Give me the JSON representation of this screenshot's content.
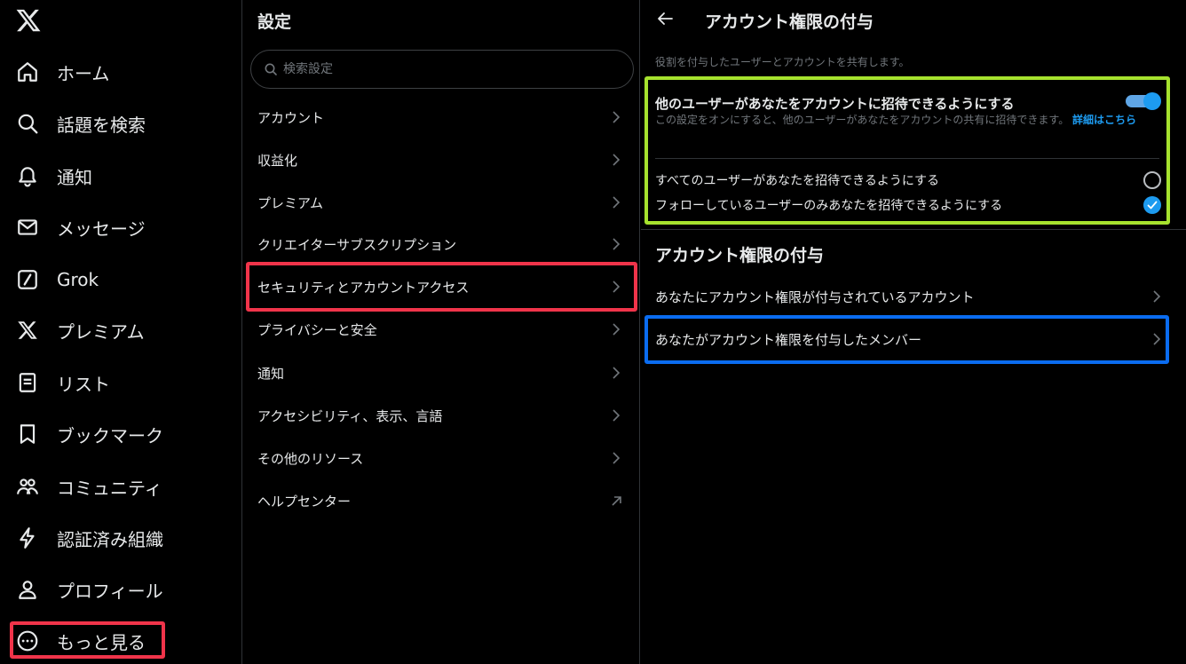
{
  "colors": {
    "accent": "#1d9bf0",
    "highlight_red": "#f0344a",
    "highlight_green": "#a6e22e",
    "highlight_blue": "#0a6cf0"
  },
  "nav": {
    "logo_icon": "x-logo-icon",
    "items": [
      {
        "label": "ホーム",
        "icon": "home-icon"
      },
      {
        "label": "話題を検索",
        "icon": "search-icon"
      },
      {
        "label": "通知",
        "icon": "bell-icon"
      },
      {
        "label": "メッセージ",
        "icon": "mail-icon"
      },
      {
        "label": "Grok",
        "icon": "grok-icon"
      },
      {
        "label": "プレミアム",
        "icon": "x-logo-icon"
      },
      {
        "label": "リスト",
        "icon": "list-icon"
      },
      {
        "label": "ブックマーク",
        "icon": "bookmark-icon"
      },
      {
        "label": "コミュニティ",
        "icon": "people-icon"
      },
      {
        "label": "認証済み組織",
        "icon": "lightning-icon"
      },
      {
        "label": "プロフィール",
        "icon": "person-icon"
      },
      {
        "label": "もっと見る",
        "icon": "more-circle-icon"
      }
    ]
  },
  "settings": {
    "title": "設定",
    "search_placeholder": "検索設定",
    "items": [
      {
        "label": "アカウント",
        "icon": "chevron-right-icon"
      },
      {
        "label": "収益化",
        "icon": "chevron-right-icon"
      },
      {
        "label": "プレミアム",
        "icon": "chevron-right-icon"
      },
      {
        "label": "クリエイターサブスクリプション",
        "icon": "chevron-right-icon"
      },
      {
        "label": "セキュリティとアカウントアクセス",
        "icon": "chevron-right-icon"
      },
      {
        "label": "プライバシーと安全",
        "icon": "chevron-right-icon"
      },
      {
        "label": "通知",
        "icon": "chevron-right-icon"
      },
      {
        "label": "アクセシビリティ、表示、言語",
        "icon": "chevron-right-icon"
      },
      {
        "label": "その他のリソース",
        "icon": "chevron-right-icon"
      },
      {
        "label": "ヘルプセンター",
        "icon": "external-link-icon"
      }
    ]
  },
  "detail": {
    "title": "アカウント権限の付与",
    "description": "役割を付与したユーザーとアカウントを共有します。",
    "toggle": {
      "title": "他のユーザーがあなたをアカウントに招待できるようにする",
      "enabled": true,
      "help": "この設定をオンにすると、他のユーザーがあなたをアカウントの共有に招待できます。",
      "link": "詳細はこちら"
    },
    "radio_options": [
      {
        "label": "すべてのユーザーがあなたを招待できるようにする",
        "selected": false
      },
      {
        "label": "フォローしているユーザーのみあなたを招待できるようにする",
        "selected": true
      }
    ],
    "section_heading": "アカウント権限の付与",
    "items": [
      {
        "label": "あなたにアカウント権限が付与されているアカウント"
      },
      {
        "label": "あなたがアカウント権限を付与したメンバー"
      }
    ]
  }
}
